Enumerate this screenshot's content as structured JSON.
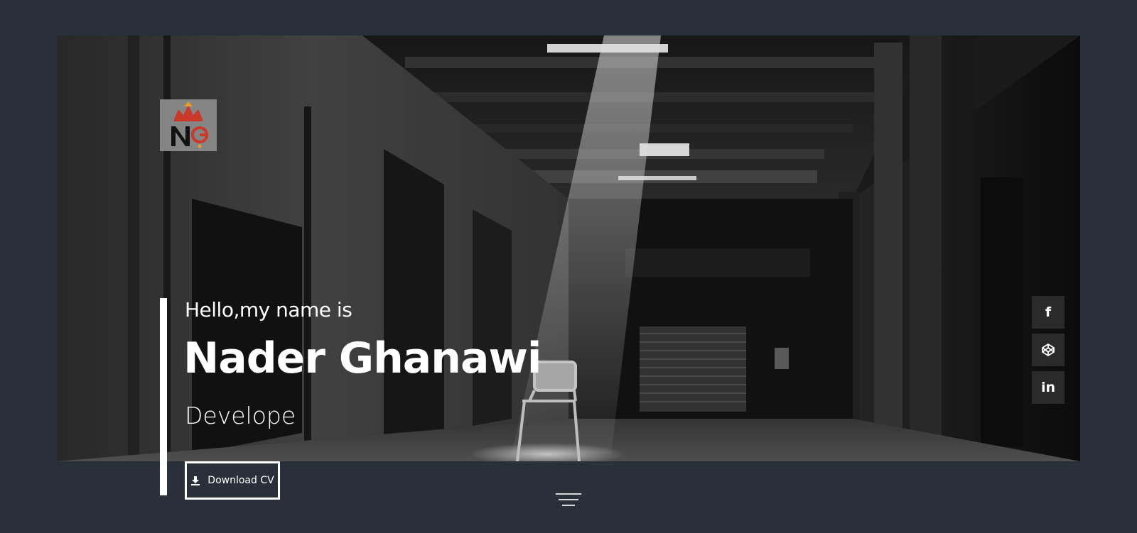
{
  "hero": {
    "greeting": "Hello,my name is",
    "name": "Nader Ghanawi",
    "role": "Develope",
    "download_label": "Download CV"
  },
  "logo": {
    "text": "NG"
  },
  "social": [
    {
      "icon": "facebook-icon",
      "glyph": "f"
    },
    {
      "icon": "codepen-icon",
      "glyph": ""
    },
    {
      "icon": "linkedin-icon",
      "glyph": "in"
    }
  ],
  "menu": {
    "icon": "hamburger-menu-icon"
  },
  "colors": {
    "background": "#2a3039",
    "text": "#ffffff",
    "social_bg": "#2a2a2a"
  }
}
